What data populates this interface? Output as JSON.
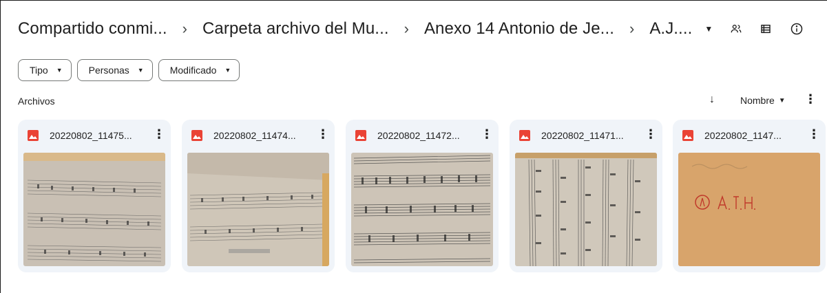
{
  "breadcrumb": {
    "items": [
      "Compartido conmi...",
      "Carpeta archivo del Mu...",
      "Anexo 14 Antonio de Je...",
      "A.J...."
    ],
    "separator": "›"
  },
  "toolbar": {
    "icons": [
      "dropdown-caret",
      "manage-access-icon",
      "list-view-icon",
      "details-info-icon"
    ]
  },
  "filters": [
    {
      "label": "Tipo"
    },
    {
      "label": "Personas"
    },
    {
      "label": "Modificado"
    }
  ],
  "section": {
    "title": "Archivos",
    "sort_label": "Nombre",
    "sort_direction": "descending"
  },
  "files": [
    {
      "name": "20220802_11475...",
      "type": "image",
      "thumb": "sheet-music-1"
    },
    {
      "name": "20220802_11474...",
      "type": "image",
      "thumb": "sheet-music-2"
    },
    {
      "name": "20220802_11472...",
      "type": "image",
      "thumb": "sheet-music-3"
    },
    {
      "name": "20220802_11471...",
      "type": "image",
      "thumb": "sheet-music-4"
    },
    {
      "name": "20220802_1147...",
      "type": "image",
      "thumb": "title-page"
    }
  ],
  "colors": {
    "card_bg": "#f0f4f9",
    "image_icon": "#ea4335",
    "text": "#1f1f1f",
    "chip_border": "#747775"
  }
}
